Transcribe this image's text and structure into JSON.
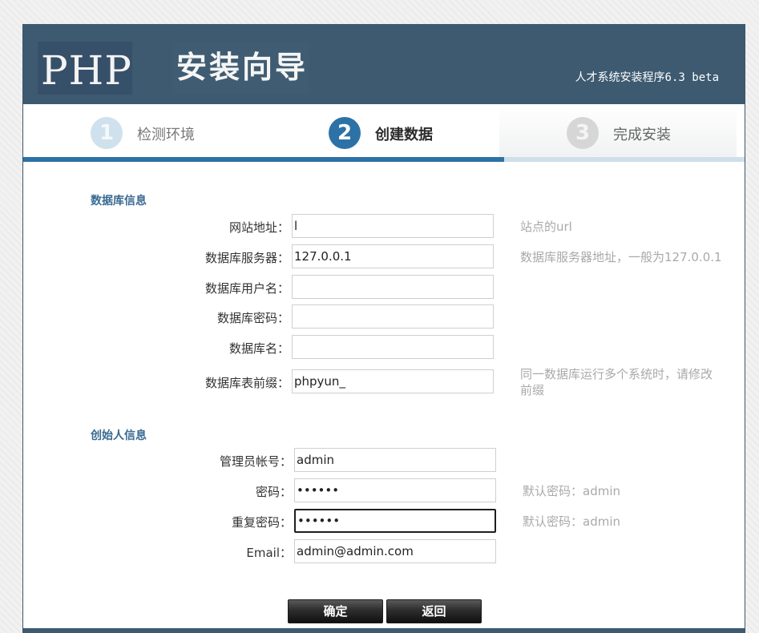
{
  "header": {
    "logo_text": "PHP",
    "wizard_title": "安装向导",
    "version": "人才系统安装程序6.3 beta"
  },
  "steps": [
    {
      "number": "1",
      "label": "检测环境",
      "state": "done"
    },
    {
      "number": "2",
      "label": "创建数据",
      "state": "active"
    },
    {
      "number": "3",
      "label": "完成安装",
      "state": "pending"
    }
  ],
  "progress": {
    "completed_steps": 2,
    "total_steps": 3
  },
  "db_section": {
    "title": "数据库信息",
    "fields": {
      "site_url": {
        "label": "网站地址：",
        "value": "l",
        "hint": "站点的url"
      },
      "db_host": {
        "label": "数据库服务器：",
        "value": "127.0.0.1",
        "hint": "数据库服务器地址，一般为127.0.0.1"
      },
      "db_user": {
        "label": "数据库用户名：",
        "value": ""
      },
      "db_password": {
        "label": "数据库密码：",
        "value": ""
      },
      "db_name": {
        "label": "数据库名：",
        "value": ""
      },
      "table_prefix": {
        "label": "数据库表前缀：",
        "value": "phpyun_",
        "hint": "同一数据库运行多个系统时，请修改前缀"
      }
    }
  },
  "founder_section": {
    "title": "创始人信息",
    "fields": {
      "admin_account": {
        "label": "管理员帐号：",
        "value": "admin"
      },
      "password": {
        "label": "密码：",
        "value": "••••••",
        "hint": "默认密码：admin"
      },
      "repeat_password": {
        "label": "重复密码：",
        "value": "••••••",
        "hint": "默认密码：admin"
      },
      "email": {
        "label": "Email：",
        "value": "admin@admin.com"
      }
    }
  },
  "buttons": {
    "confirm": "确定",
    "back": "返回"
  },
  "colors": {
    "header_bg": "#3d5a70",
    "accent": "#2d72a6",
    "section_title": "#3a6a92",
    "hint": "#a9a9a9"
  }
}
